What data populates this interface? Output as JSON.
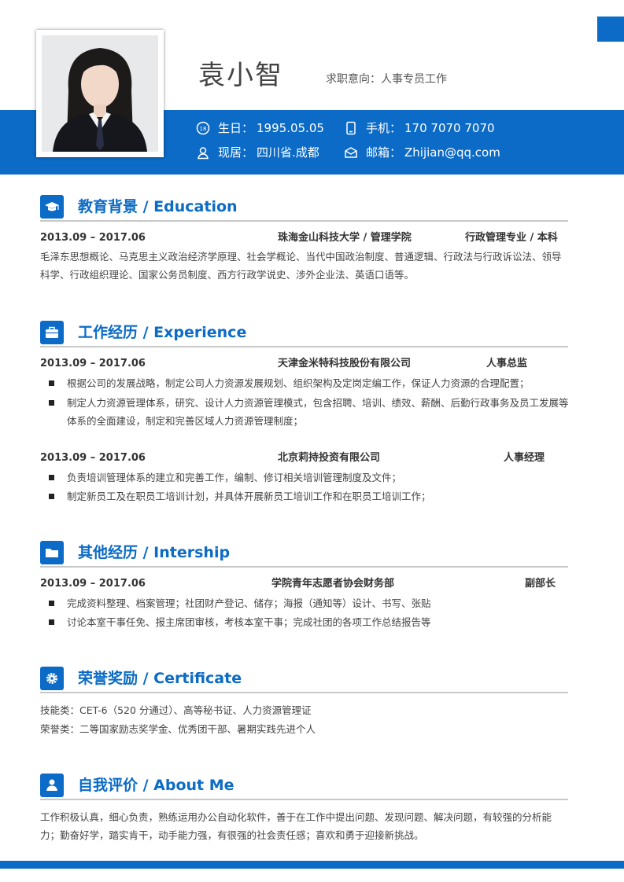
{
  "header": {
    "name": "袁小智",
    "intent": "求职意向：人事专员工作",
    "birthday_label": "生日：",
    "birthday": "1995.05.05",
    "phone_label": "手机：",
    "phone": "170 7070 7070",
    "residence_label": "现居：",
    "residence": "四川省.成都",
    "email_label": "邮箱：",
    "email": "Zhijian@qq.com"
  },
  "education": {
    "title": "教育背景 / Education",
    "date": "2013.09 – 2017.06",
    "school": "珠海金山科技大学 / 管理学院",
    "major": "行政管理专业 / 本科",
    "courses": "毛泽东思想概论、马克思主义政治经济学原理、社会学概论、当代中国政治制度、普通逻辑、行政法与行政诉讼法、领导科学、行政组织理论、国家公务员制度、西方行政学说史、涉外企业法、英语口语等。"
  },
  "experience": {
    "title": "工作经历 / Experience",
    "jobs": [
      {
        "date": "2013.09 – 2017.06",
        "company": "天津金米特科技股份有限公司",
        "position": "人事总监",
        "items": [
          "根据公司的发展战略，制定公司人力资源发展规划、组织架构及定岗定编工作，保证人力资源的合理配置；",
          "制定人力资源管理体系，研究、设计人力资源管理模式，包含招聘、培训、绩效、薪酬、后勤行政事务及员工发展等体系的全面建设，制定和完善区域人力资源管理制度；"
        ]
      },
      {
        "date": "2013.09 – 2017.06",
        "company": "北京莉持投资有限公司",
        "position": "人事经理",
        "items": [
          "负责培训管理体系的建立和完善工作，编制、修订相关培训管理制度及文件；",
          "制定新员工及在职员工培训计划，并具体开展新员工培训工作和在职员工培训工作；"
        ]
      }
    ]
  },
  "internship": {
    "title": "其他经历 / Intership",
    "date": "2013.09 – 2017.06",
    "org": "学院青年志愿者协会财务部",
    "position": "副部长",
    "items": [
      "完成资料整理、档案管理；社团财产登记、储存；海报（通知等）设计、书写、张贴",
      "讨论本室干事任免、报主席团审核，考核本室干事；完成社团的各项工作总结报告等"
    ]
  },
  "certificate": {
    "title": "荣誉奖励 / Certificate",
    "skills": "技能类：CET-6（520 分通过）、高等秘书证、人力资源管理证",
    "honors": "荣誉类：二等国家励志奖学金、优秀团干部、暑期实践先进个人"
  },
  "about": {
    "title": "自我评价 / About Me",
    "text": "工作积极认真，细心负责，熟练运用办公自动化软件，善于在工作中提出问题、发现问题、解决问题，有较强的分析能力；勤奋好学，踏实肯干，动手能力强，有很强的社会责任感；喜欢和勇于迎接新挑战。"
  },
  "colors": {
    "accent": "#0b6bc6",
    "text": "#444444",
    "rule": "#c8c8c8"
  },
  "icons": [
    "birthday-icon",
    "phone-icon",
    "location-icon",
    "email-icon",
    "graduation-cap-icon",
    "briefcase-icon",
    "folder-icon",
    "gear-icon",
    "person-icon"
  ]
}
